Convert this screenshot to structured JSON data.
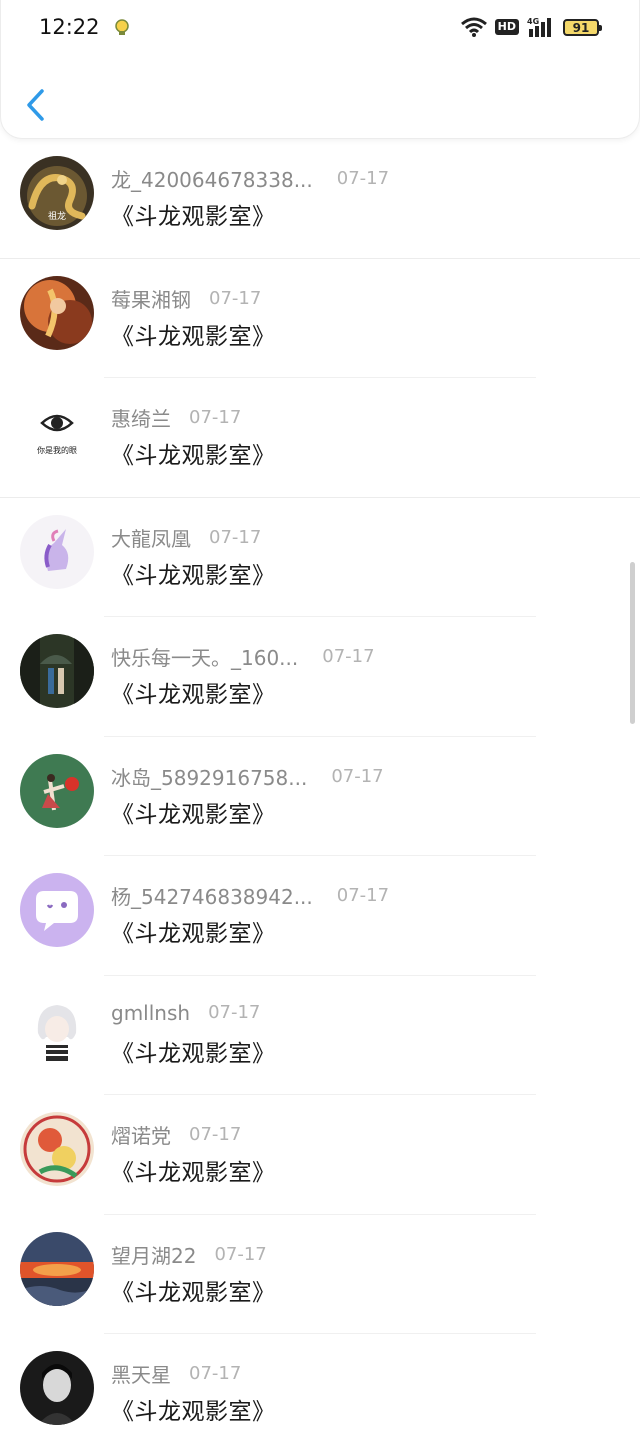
{
  "status_bar": {
    "time": "12:22",
    "network": "4G",
    "hd": "HD",
    "battery": "91"
  },
  "colors": {
    "accent": "#2f9ae8",
    "username": "#8a8a8a",
    "date": "#b3b3b3",
    "message": "#1a1a1a"
  },
  "items": [
    {
      "username": "龙_420064678338...",
      "date": "07-17",
      "message": "《斗龙观影室》",
      "avatar": "dragon-avatar",
      "avatar_text": "祖龙"
    },
    {
      "username": "莓果湘钢",
      "date": "07-17",
      "message": "《斗龙观影室》",
      "avatar": "anime-warrior-avatar"
    },
    {
      "username": "惠绮兰",
      "date": "07-17",
      "message": "《斗龙观影室》",
      "avatar": "eye-avatar",
      "avatar_text": "你是我的眼"
    },
    {
      "username": "大龍凤凰",
      "date": "07-17",
      "message": "《斗龙观影室》",
      "avatar": "unicorn-avatar"
    },
    {
      "username": "快乐每一天。_160...",
      "date": "07-17",
      "message": "《斗龙观影室》",
      "avatar": "umbrella-couple-avatar"
    },
    {
      "username": "冰岛_5892916758...",
      "date": "07-17",
      "message": "《斗龙观影室》",
      "avatar": "girl-balloon-avatar"
    },
    {
      "username": "杨_542746838942...",
      "date": "07-17",
      "message": "《斗龙观影室》",
      "avatar": "chat-bubble-avatar"
    },
    {
      "username": "gmllnsh",
      "date": "07-17",
      "message": "《斗龙观影室》",
      "avatar": "anime-girl-avatar"
    },
    {
      "username": "熠诺党",
      "date": "07-17",
      "message": "《斗龙观影室》",
      "avatar": "anime-boys-avatar"
    },
    {
      "username": "望月湖22",
      "date": "07-17",
      "message": "《斗龙观影室》",
      "avatar": "sunset-avatar"
    },
    {
      "username": "黑天星",
      "date": "07-17",
      "message": "《斗龙观影室》",
      "avatar": "dark-portrait-avatar"
    }
  ]
}
